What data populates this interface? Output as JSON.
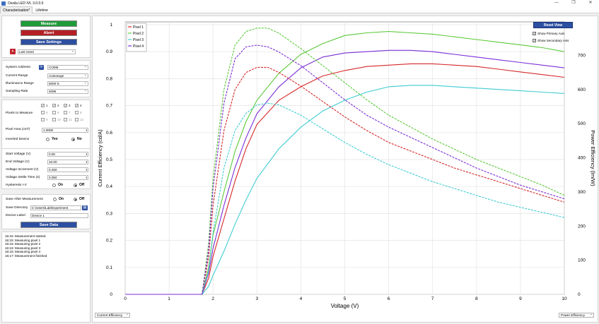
{
  "window": {
    "title": "Ossila LED IVL 3.0.0.0",
    "controls": [
      "—",
      "❐",
      "✕"
    ]
  },
  "tabs": [
    {
      "label": "Characterisation*",
      "active": true
    },
    {
      "label": "Lifetime",
      "active": false
    }
  ],
  "actions": {
    "measure": "Measure",
    "abort": "Abort",
    "save_settings": "Save Settings",
    "preset": "Last Used",
    "colors": {
      "measure": "#1f9b3a",
      "abort": "#b51f24",
      "settings": "#2d4fa1"
    }
  },
  "device": {
    "system_address_label": "System Address:",
    "system_address": "COM6",
    "current_range_label": "Current Range",
    "current_range": "Autorange",
    "illuminance_label": "Illuminance Range",
    "illuminance": "5000 lx",
    "sampling_label": "Sampling Rate",
    "sampling": "4096"
  },
  "pixels": {
    "label": "Pixels to Measure",
    "items": [
      {
        "n": "1",
        "checked": true
      },
      {
        "n": "2",
        "checked": true
      },
      {
        "n": "3",
        "checked": true
      },
      {
        "n": "4",
        "checked": true
      },
      {
        "n": "5",
        "checked": false
      },
      {
        "n": "6",
        "checked": false
      },
      {
        "n": "7",
        "checked": false
      },
      {
        "n": "8",
        "checked": false
      },
      {
        "n": "9",
        "checked": false
      },
      {
        "n": "10",
        "checked": false
      },
      {
        "n": "11",
        "checked": false
      },
      {
        "n": "12",
        "checked": false
      }
    ],
    "area_label": "Pixel Area (cm²)",
    "area": "1.0000",
    "inverted_label": "Inverted Device",
    "yes": "Yes",
    "no": "No"
  },
  "voltage": {
    "start_label": "Start Voltage (V)",
    "start": "0.00",
    "end_label": "End Voltage (V)",
    "end": "10.00",
    "inc_label": "Voltage Increment (V)",
    "inc": "0.250",
    "settle_label": "Voltage Settle Time (s)",
    "settle": "0.050",
    "hyst_label": "Hysteresis I-V",
    "on": "On",
    "off": "Off"
  },
  "save": {
    "after_label": "Save After Measurement",
    "on": "On",
    "off": "Off",
    "dir_label": "Save Directory",
    "dir": "C:\\Users\\Lab\\Experiment",
    "device_label_label": "Device Label",
    "device_label": "Device 1",
    "save_data": "Save Data"
  },
  "log": [
    "16:15: Measurement started",
    "16:15: Measuring pixel 1",
    "16:15: Measuring pixel 2",
    "16:16: Measuring pixel 3",
    "16:16: Measuring pixel 4",
    "16:17: Measurement finished"
  ],
  "plot_controls": {
    "reset_view": "Reset View",
    "show_primary": "Show Primary Axis",
    "show_secondary": "Show Secondary Axis",
    "primary_select": "Current Efficiency",
    "secondary_select": "Power Efficiency"
  },
  "chart_data": {
    "type": "line",
    "xlabel": "Voltage (V)",
    "ylabel": "Current Efficiency (cd/A)",
    "y2label": "Power Efficiency (lm/W)",
    "xlim": [
      0,
      10
    ],
    "ylim": [
      0,
      1
    ],
    "y2lim": [
      0,
      800
    ],
    "xticks": [
      0,
      1,
      2,
      3,
      4,
      5,
      6,
      7,
      8,
      9,
      10
    ],
    "yticks": [
      0,
      0.1,
      0.2,
      0.3,
      0.4,
      0.5,
      0.6,
      0.7,
      0.8,
      0.9,
      1
    ],
    "y2ticks": [
      0,
      100,
      200,
      300,
      400,
      500,
      600,
      700
    ],
    "grid": true,
    "legend": "top-left",
    "series": [
      {
        "name": "Pixel 1",
        "color": "#d62728",
        "axis": "primary",
        "x": [
          0,
          1.75,
          1.9,
          2.0,
          2.25,
          2.5,
          2.75,
          3.0,
          3.5,
          4.0,
          4.5,
          5.0,
          5.5,
          6.0,
          6.5,
          7.0,
          7.5,
          8.0,
          8.5,
          9.0,
          9.5,
          10.0
        ],
        "y": [
          0,
          0,
          0.06,
          0.14,
          0.28,
          0.42,
          0.54,
          0.63,
          0.72,
          0.77,
          0.81,
          0.83,
          0.845,
          0.85,
          0.855,
          0.855,
          0.85,
          0.845,
          0.835,
          0.825,
          0.815,
          0.805
        ]
      },
      {
        "name": "Pixel 2",
        "color": "#5cc93a",
        "axis": "primary",
        "x": [
          0,
          1.75,
          1.9,
          2.0,
          2.25,
          2.5,
          2.75,
          3.0,
          3.5,
          4.0,
          4.5,
          5.0,
          5.5,
          6.0,
          6.5,
          7.0,
          7.5,
          8.0,
          8.5,
          9.0,
          9.5,
          10.0
        ],
        "y": [
          0,
          0,
          0.1,
          0.22,
          0.38,
          0.53,
          0.64,
          0.72,
          0.82,
          0.89,
          0.93,
          0.96,
          0.97,
          0.975,
          0.97,
          0.965,
          0.955,
          0.945,
          0.935,
          0.925,
          0.915,
          0.9
        ]
      },
      {
        "name": "Pixel 3",
        "color": "#3fcbd1",
        "axis": "primary",
        "x": [
          0,
          1.75,
          1.9,
          2.0,
          2.25,
          2.5,
          2.75,
          3.0,
          3.5,
          4.0,
          4.5,
          5.0,
          5.5,
          6.0,
          6.5,
          7.0,
          7.5,
          8.0,
          8.5,
          9.0,
          9.5,
          10.0
        ],
        "y": [
          0,
          0,
          0.03,
          0.07,
          0.16,
          0.26,
          0.35,
          0.43,
          0.54,
          0.62,
          0.68,
          0.72,
          0.75,
          0.77,
          0.775,
          0.775,
          0.77,
          0.765,
          0.76,
          0.755,
          0.75,
          0.745
        ]
      },
      {
        "name": "Pixel 4",
        "color": "#7b2fd6",
        "axis": "primary",
        "x": [
          0,
          1.75,
          1.9,
          2.0,
          2.25,
          2.5,
          2.75,
          3.0,
          3.5,
          4.0,
          4.5,
          5.0,
          5.5,
          6.0,
          6.5,
          7.0,
          7.5,
          8.0,
          8.5,
          9.0,
          9.5,
          10.0
        ],
        "y": [
          0,
          0,
          0.08,
          0.17,
          0.33,
          0.47,
          0.58,
          0.67,
          0.77,
          0.84,
          0.88,
          0.895,
          0.9,
          0.905,
          0.905,
          0.9,
          0.89,
          0.88,
          0.87,
          0.86,
          0.85,
          0.84
        ]
      },
      {
        "name": "",
        "color": "#d62728",
        "axis": "secondary",
        "dashed": true,
        "x": [
          0,
          1.75,
          1.9,
          2.0,
          2.25,
          2.5,
          2.75,
          3.0,
          3.25,
          3.5,
          4.0,
          4.5,
          5.0,
          5.5,
          6.0,
          6.5,
          7.0,
          7.5,
          8.0,
          8.5,
          9.0,
          9.5,
          10.0
        ],
        "y": [
          0,
          0,
          110,
          260,
          480,
          600,
          650,
          665,
          665,
          650,
          610,
          565,
          520,
          480,
          445,
          420,
          395,
          370,
          350,
          330,
          310,
          290,
          270
        ]
      },
      {
        "name": "",
        "color": "#5cc93a",
        "axis": "secondary",
        "dashed": true,
        "x": [
          0,
          1.75,
          1.9,
          2.0,
          2.25,
          2.5,
          2.75,
          3.0,
          3.25,
          3.5,
          4.0,
          4.5,
          5.0,
          5.5,
          6.0,
          6.5,
          7.0,
          7.5,
          8.0,
          8.5,
          9.0,
          9.5,
          10.0
        ],
        "y": [
          0,
          0,
          150,
          340,
          600,
          730,
          770,
          780,
          780,
          765,
          720,
          670,
          620,
          570,
          525,
          490,
          455,
          425,
          395,
          370,
          345,
          320,
          290
        ]
      },
      {
        "name": "",
        "color": "#3fcbd1",
        "axis": "secondary",
        "dashed": true,
        "x": [
          0,
          1.75,
          1.9,
          2.0,
          2.25,
          2.5,
          2.75,
          3.0,
          3.25,
          3.5,
          4.0,
          4.5,
          5.0,
          5.5,
          6.0,
          6.5,
          7.0,
          7.5,
          8.0,
          8.5,
          9.0,
          9.5,
          10.0
        ],
        "y": [
          0,
          0,
          70,
          180,
          370,
          480,
          530,
          555,
          560,
          555,
          525,
          485,
          445,
          410,
          380,
          355,
          330,
          310,
          290,
          270,
          255,
          240,
          225
        ]
      },
      {
        "name": "",
        "color": "#7b2fd6",
        "axis": "secondary",
        "dashed": true,
        "x": [
          0,
          1.75,
          1.9,
          2.0,
          2.25,
          2.5,
          2.75,
          3.0,
          3.25,
          3.5,
          4.0,
          4.5,
          5.0,
          5.5,
          6.0,
          6.5,
          7.0,
          7.5,
          8.0,
          8.5,
          9.0,
          9.5,
          10.0
        ],
        "y": [
          0,
          0,
          130,
          310,
          560,
          690,
          725,
          730,
          725,
          710,
          670,
          620,
          570,
          525,
          490,
          460,
          430,
          400,
          370,
          345,
          320,
          300,
          280
        ]
      }
    ]
  }
}
